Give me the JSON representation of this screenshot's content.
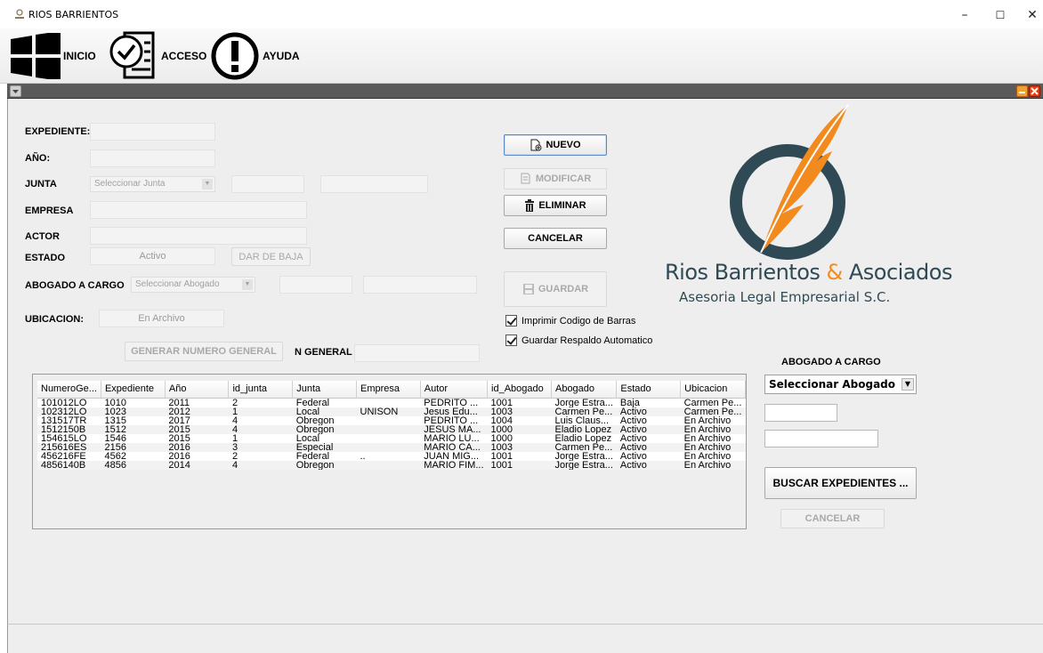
{
  "window": {
    "title": "RIOS BARRIENTOS",
    "minimize": "–",
    "maximize": "☐",
    "close": "✕"
  },
  "menu": [
    {
      "label": "INICIO",
      "icon": "windows-icon"
    },
    {
      "label": "ACCESO",
      "icon": "checklist-icon"
    },
    {
      "label": "AYUDA",
      "icon": "alert-icon"
    }
  ],
  "form": {
    "expediente_label": "EXPEDIENTE:",
    "anio_label": "AÑO:",
    "junta_label": "JUNTA",
    "junta_select": "Seleccionar Junta",
    "empresa_label": "EMPRESA",
    "actor_label": "ACTOR",
    "estado_label": "ESTADO",
    "estado_value": "Activo",
    "dar_baja_button": "DAR DE BAJA",
    "abogado_label": "ABOGADO A CARGO",
    "abogado_select": "Seleccionar Abogado",
    "ubicacion_label": "UBICACION:",
    "ubicacion_value": "En Archivo",
    "generar_button": "GENERAR NUMERO GENERAL",
    "n_general_label": "N GENERAL"
  },
  "actions": {
    "nuevo": "NUEVO",
    "modificar": "MODIFICAR",
    "eliminar": "ELIMINAR",
    "cancelar": "CANCELAR",
    "guardar": "GUARDAR",
    "imprimir_check": "Imprimir Codigo de Barras",
    "respaldo_check": "Guardar Respaldo Automatico"
  },
  "logo": {
    "line1_a": "Rios Barrientos ",
    "line1_amp": "&",
    "line1_b": " Asociados",
    "line2": "Asesoria Legal Empresarial S.C.",
    "colors": {
      "ring": "#2f4a55",
      "feather": "#f28a1e"
    }
  },
  "table": {
    "columns": [
      "NumeroGe...",
      "Expediente",
      "Año",
      "id_junta",
      "Junta",
      "Empresa",
      "Autor",
      "id_Abogado",
      "Abogado",
      "Estado",
      "Ubicacion"
    ],
    "rows": [
      [
        "101012LO",
        "1010",
        "2011",
        "2",
        "Federal",
        "",
        "PEDRITO ...",
        "1001",
        "Jorge Estra...",
        "Baja",
        "Carmen Pe..."
      ],
      [
        "102312LO",
        "1023",
        "2012",
        "1",
        "Local",
        "UNISON",
        "Jesus Edu...",
        "1003",
        "Carmen Pe...",
        "Activo",
        "Carmen Pe..."
      ],
      [
        "131517TR",
        "1315",
        "2017",
        "4",
        "Obregon",
        "",
        "PEDRITO ...",
        "1004",
        "Luis Claus...",
        "Activo",
        "En Archivo"
      ],
      [
        "1512150B",
        "1512",
        "2015",
        "4",
        "Obregon",
        "",
        "JESUS MA...",
        "1000",
        "Eladio Lopez",
        "Activo",
        "En Archivo"
      ],
      [
        "154615LO",
        "1546",
        "2015",
        "1",
        "Local",
        "",
        "MARIO LU...",
        "1000",
        "Eladio Lopez",
        "Activo",
        "En Archivo"
      ],
      [
        "215616ES",
        "2156",
        "2016",
        "3",
        "Especial",
        "",
        "MARIO CA...",
        "1003",
        "Carmen Pe...",
        "Activo",
        "En Archivo"
      ],
      [
        "456216FE",
        "4562",
        "2016",
        "2",
        "Federal",
        "..",
        "JUAN MIG...",
        "1001",
        "Jorge Estra...",
        "Activo",
        "En Archivo"
      ],
      [
        "4856140B",
        "4856",
        "2014",
        "4",
        "Obregon",
        "",
        "MARIO FIM...",
        "1001",
        "Jorge Estra...",
        "Activo",
        "En Archivo"
      ]
    ]
  },
  "search": {
    "abogado_heading": "ABOGADO A CARGO",
    "abogado_select": "Seleccionar Abogado",
    "buscar_button": "BUSCAR EXPEDIENTES ...",
    "cancelar_button": "CANCELAR"
  }
}
